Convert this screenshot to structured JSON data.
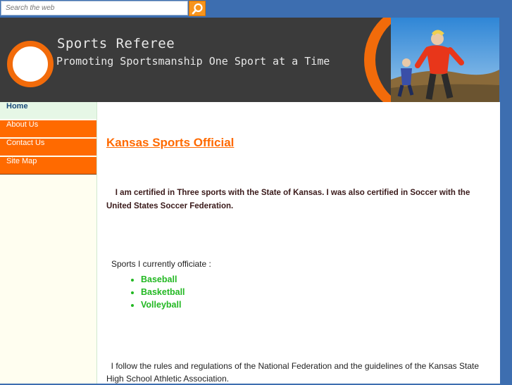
{
  "search": {
    "placeholder": "Search the web",
    "button_icon": "search-icon"
  },
  "header": {
    "title": "Sports Referee",
    "tagline": "Promoting Sportsmanship One Sport at a Time",
    "logo_icon": "circle-logo-icon",
    "colors": {
      "bg": "#3b3b3b",
      "accent": "#f26b0a"
    }
  },
  "sidebar": {
    "items": [
      {
        "label": "Home",
        "active": true
      },
      {
        "label": "About Us"
      },
      {
        "label": "Contact Us"
      },
      {
        "label": "Site Map"
      }
    ],
    "colors": {
      "item_bg": "#ff6a00",
      "active_bg": "#e6f7e6"
    }
  },
  "main": {
    "heading": "Kansas Sports Official",
    "intro": "I am certified in Three sports with the State of Kansas. I was also certified in Soccer with the United States Soccer Federation.",
    "sports_label": "Sports I currently officiate :",
    "sports": [
      "Baseball",
      "Basketball",
      "Volleyball"
    ],
    "rules": "I follow the rules and regulations of the National Federation and the guidelines of the Kansas State High School Athletic Association."
  }
}
